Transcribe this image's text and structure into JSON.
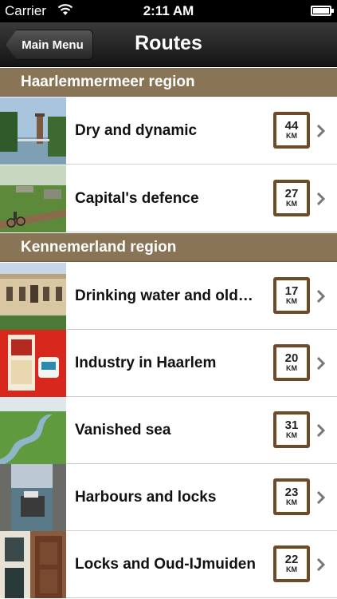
{
  "status_bar": {
    "carrier": "Carrier",
    "time": "2:11 AM"
  },
  "nav": {
    "back_label": "Main Menu",
    "title": "Routes"
  },
  "sections": [
    {
      "title": "Haarlemmermeer region",
      "routes": [
        {
          "name": "Dry and dynamic",
          "km": "44",
          "unit": "KM"
        },
        {
          "name": "Capital's defence",
          "km": "27",
          "unit": "KM"
        }
      ]
    },
    {
      "title": "Kennemerland region",
      "routes": [
        {
          "name": "Drinking water and old…",
          "km": "17",
          "unit": "KM"
        },
        {
          "name": "Industry in Haarlem",
          "km": "20",
          "unit": "KM"
        },
        {
          "name": "Vanished sea",
          "km": "31",
          "unit": "KM"
        },
        {
          "name": "Harbours and locks",
          "km": "23",
          "unit": "KM"
        },
        {
          "name": "Locks and Oud-IJmuiden",
          "km": "22",
          "unit": "KM"
        }
      ]
    }
  ],
  "colors": {
    "section_header": "#8a7456",
    "km_sign": "#6e4a28"
  }
}
